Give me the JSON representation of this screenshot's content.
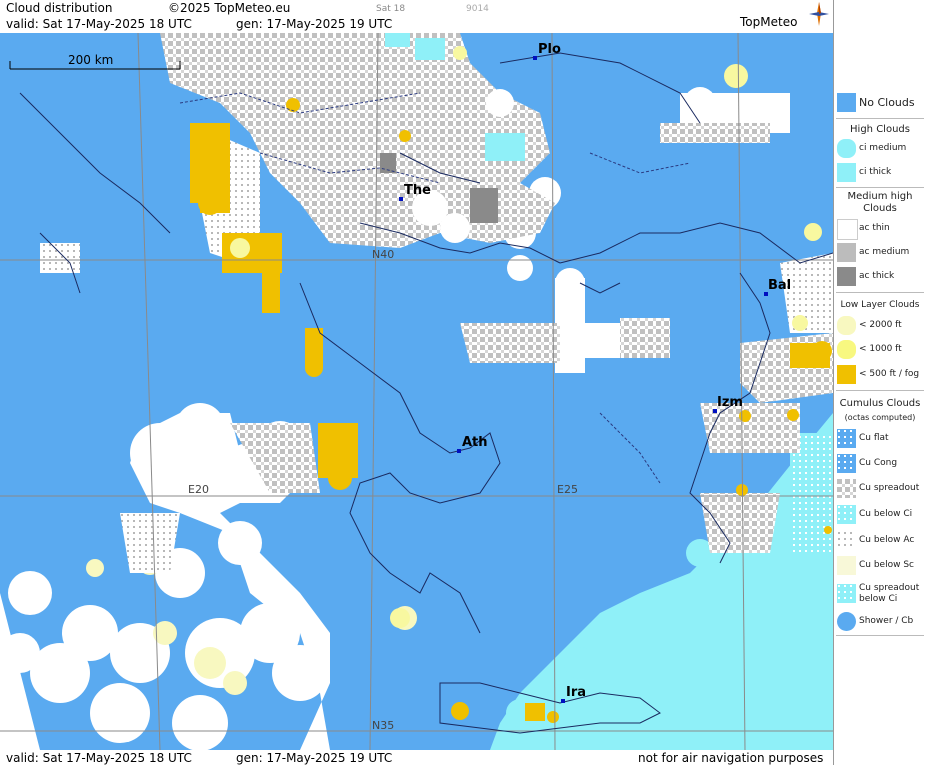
{
  "header": {
    "title": "Cloud distribution",
    "copyright": "©2025 TopMeteo.eu",
    "valid": "valid:  Sat  17-May-2025  18 UTC",
    "generated": "gen: 17-May-2025 19 UTC",
    "day_tab": "Sat 18",
    "code": "9014",
    "brand": "TopMeteo"
  },
  "footer": {
    "valid": "valid:  Sat  17-May-2025  18 UTC",
    "generated": "gen: 17-May-2025 19 UTC",
    "note": "not for air navigation purposes"
  },
  "map": {
    "scale_label": "200 km",
    "grid_labels": {
      "lat40": "N40",
      "lat35": "N35",
      "lon20": "E20",
      "lon25": "E25"
    },
    "cities": [
      {
        "abbr": "Plo"
      },
      {
        "abbr": "The"
      },
      {
        "abbr": "Bal"
      },
      {
        "abbr": "Izm"
      },
      {
        "abbr": "Ath"
      },
      {
        "abbr": "Ira"
      }
    ]
  },
  "legend": {
    "no_clouds": "No Clouds",
    "high_title": "High Clouds",
    "high": [
      "ci medium",
      "ci thick"
    ],
    "medium_title": "Medium high Clouds",
    "medium": [
      "ac thin",
      "ac medium",
      "ac thick"
    ],
    "low_title": "Low Layer Clouds",
    "low": [
      "< 2000 ft",
      "< 1000 ft",
      "< 500 ft / fog"
    ],
    "cu_title": "Cumulus Clouds",
    "cu_subtitle": "(octas computed)",
    "cu": [
      "Cu flat",
      "Cu Cong",
      "Cu spreadout",
      "Cu below Ci",
      "Cu below Ac",
      "Cu below Sc",
      "Cu spreadout below Ci",
      "Shower / Cb"
    ]
  },
  "colors": {
    "sea_clear": "#5aaaf0",
    "high_cloud": "#8ff0f8",
    "ac_medium": "#bcbcbc",
    "ac_thick": "#8a8a8a",
    "low_yellow": "#f0c000",
    "low_pale": "#f8f8c0"
  }
}
